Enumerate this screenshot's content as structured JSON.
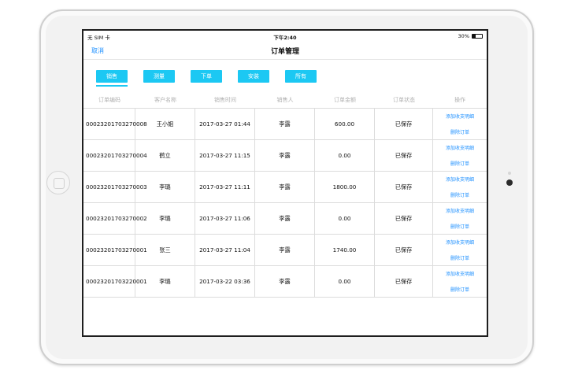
{
  "status_bar": {
    "carrier": "无 SIM 卡",
    "time": "下午2:40",
    "battery": "30%",
    "battery_level": 0.3
  },
  "nav": {
    "cancel": "取消",
    "title": "订单管理"
  },
  "tabs": [
    {
      "label": "销售",
      "selected": true
    },
    {
      "label": "测量",
      "selected": false
    },
    {
      "label": "下单",
      "selected": false
    },
    {
      "label": "安装",
      "selected": false
    },
    {
      "label": "所有",
      "selected": false
    }
  ],
  "table": {
    "headers": [
      "订单编码",
      "客户名称",
      "销售时间",
      "销售人",
      "订单金额",
      "订单状态",
      "操作"
    ],
    "rows": [
      {
        "code": "00023201703270008",
        "customer": "王小姐",
        "time": "2017-03-27 01:44",
        "seller": "李露",
        "amount": "600.00",
        "status": "已保存",
        "op1": "添加收支明细",
        "op2": "删除订单"
      },
      {
        "code": "00023201703270004",
        "customer": "鹤立",
        "time": "2017-03-27 11:15",
        "seller": "李露",
        "amount": "0.00",
        "status": "已保存",
        "op1": "添加收支明细",
        "op2": "删除订单"
      },
      {
        "code": "00023201703270003",
        "customer": "李璐",
        "time": "2017-03-27 11:11",
        "seller": "李露",
        "amount": "1800.00",
        "status": "已保存",
        "op1": "添加收支明细",
        "op2": "删除订单"
      },
      {
        "code": "00023201703270002",
        "customer": "李璐",
        "time": "2017-03-27 11:06",
        "seller": "李露",
        "amount": "0.00",
        "status": "已保存",
        "op1": "添加收支明细",
        "op2": "删除订单"
      },
      {
        "code": "00023201703270001",
        "customer": "张三",
        "time": "2017-03-27 11:04",
        "seller": "李露",
        "amount": "1740.00",
        "status": "已保存",
        "op1": "添加收支明细",
        "op2": "删除订单"
      },
      {
        "code": "00023201703220001",
        "customer": "李璐",
        "time": "2017-03-22 03:36",
        "seller": "李露",
        "amount": "0.00",
        "status": "已保存",
        "op1": "添加收支明细",
        "op2": "删除订单"
      }
    ]
  },
  "colors": {
    "accent": "#1cc8f3",
    "link": "#1e90ff"
  }
}
